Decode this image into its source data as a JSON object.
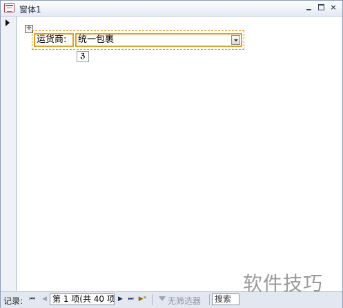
{
  "window": {
    "title": "窗体1",
    "icon": "form-icon",
    "controls": [
      "minimize-icon",
      "maximize-icon",
      "close-icon"
    ],
    "close_glyph": "×"
  },
  "form": {
    "move_handle_glyph": "✛",
    "field": {
      "label": "运货商:",
      "value": "统一包裹"
    },
    "smart_tag_glyph": "ℨ"
  },
  "nav": {
    "record_label": "记录:",
    "first_glyph": "⏮",
    "prev_glyph": "◀",
    "current": "第 1 项(共 40 项",
    "next_glyph": "▶",
    "last_glyph": "⏭",
    "new_glyph": "▶*",
    "filter_label": "无筛选器",
    "search_placeholder": "搜索"
  },
  "watermark": "软件技巧",
  "colors": {
    "accent_border": "#e2a21c",
    "titlebar": "#e4eaf3",
    "navbar": "#e3e8f0"
  }
}
